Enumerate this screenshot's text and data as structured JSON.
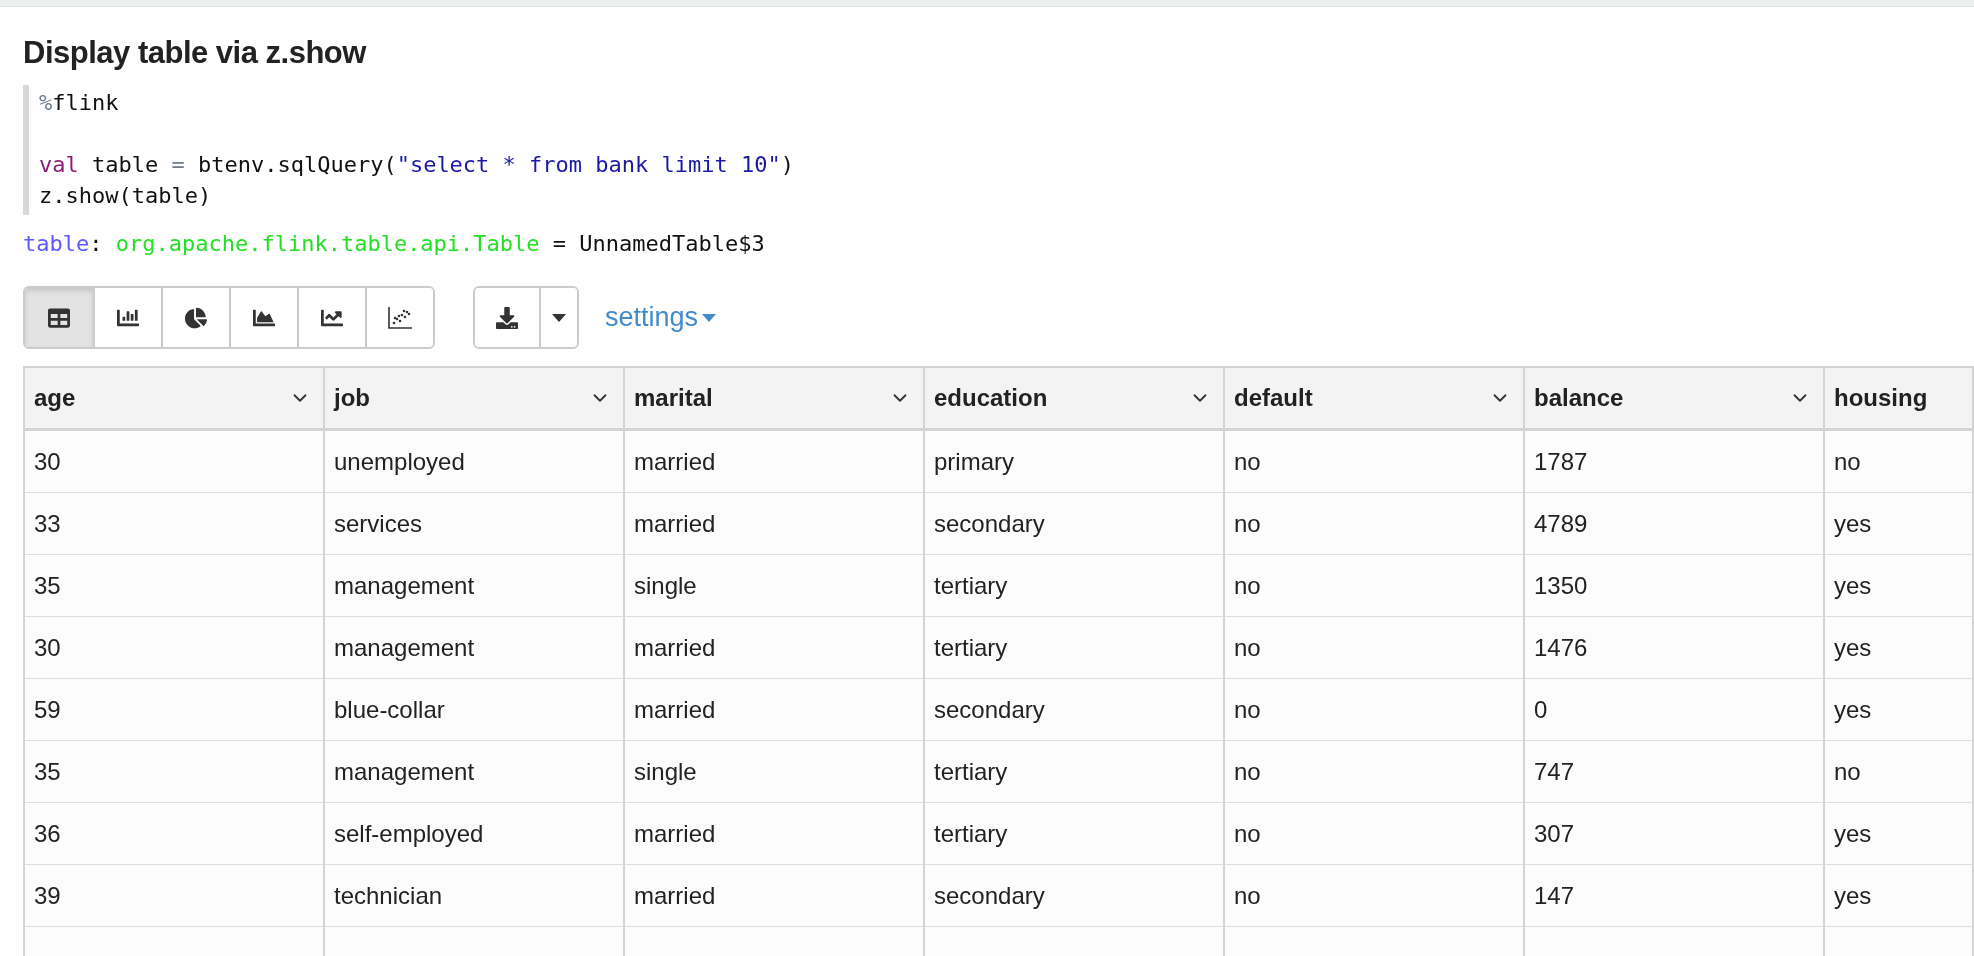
{
  "paragraph": {
    "title": "Display table via z.show",
    "code": [
      [
        {
          "kind": "percent",
          "text": "%"
        },
        {
          "kind": "plain",
          "text": "flink"
        }
      ],
      [
        {
          "kind": "blank"
        }
      ],
      [
        {
          "kind": "keyword",
          "text": "val"
        },
        {
          "kind": "plain",
          "text": " table "
        },
        {
          "kind": "operator",
          "text": "="
        },
        {
          "kind": "plain",
          "text": " btenv.sqlQuery("
        },
        {
          "kind": "string",
          "text": "\"select * from bank limit 10\""
        },
        {
          "kind": "plain",
          "text": ")"
        }
      ],
      [
        {
          "kind": "plain",
          "text": "z.show(table)"
        }
      ]
    ],
    "output": [
      {
        "kind": "name",
        "text": "table"
      },
      {
        "kind": "plain",
        "text": ": "
      },
      {
        "kind": "type",
        "text": "org.apache.flink.table.api.Table"
      },
      {
        "kind": "plain",
        "text": " = UnnamedTable$3"
      }
    ],
    "chart_buttons": [
      {
        "kind": "table",
        "selected": true
      },
      {
        "kind": "bar",
        "selected": false
      },
      {
        "kind": "pie",
        "selected": false
      },
      {
        "kind": "area",
        "selected": false
      },
      {
        "kind": "line",
        "selected": false
      },
      {
        "kind": "scatter",
        "selected": false
      }
    ],
    "settings_link": "settings",
    "table": {
      "columns": [
        {
          "label": "age",
          "menu": true
        },
        {
          "label": "job",
          "menu": true
        },
        {
          "label": "marital",
          "menu": true
        },
        {
          "label": "education",
          "menu": true
        },
        {
          "label": "default",
          "menu": true
        },
        {
          "label": "balance",
          "menu": true
        },
        {
          "label": "housing",
          "menu": false
        }
      ],
      "rows": [
        [
          "30",
          "unemployed",
          "married",
          "primary",
          "no",
          "1787",
          "no"
        ],
        [
          "33",
          "services",
          "married",
          "secondary",
          "no",
          "4789",
          "yes"
        ],
        [
          "35",
          "management",
          "single",
          "tertiary",
          "no",
          "1350",
          "yes"
        ],
        [
          "30",
          "management",
          "married",
          "tertiary",
          "no",
          "1476",
          "yes"
        ],
        [
          "59",
          "blue-collar",
          "married",
          "secondary",
          "no",
          "0",
          "yes"
        ],
        [
          "35",
          "management",
          "single",
          "tertiary",
          "no",
          "747",
          "no"
        ],
        [
          "36",
          "self-employed",
          "married",
          "tertiary",
          "no",
          "307",
          "yes"
        ],
        [
          "39",
          "technician",
          "married",
          "secondary",
          "no",
          "147",
          "yes"
        ]
      ]
    }
  }
}
